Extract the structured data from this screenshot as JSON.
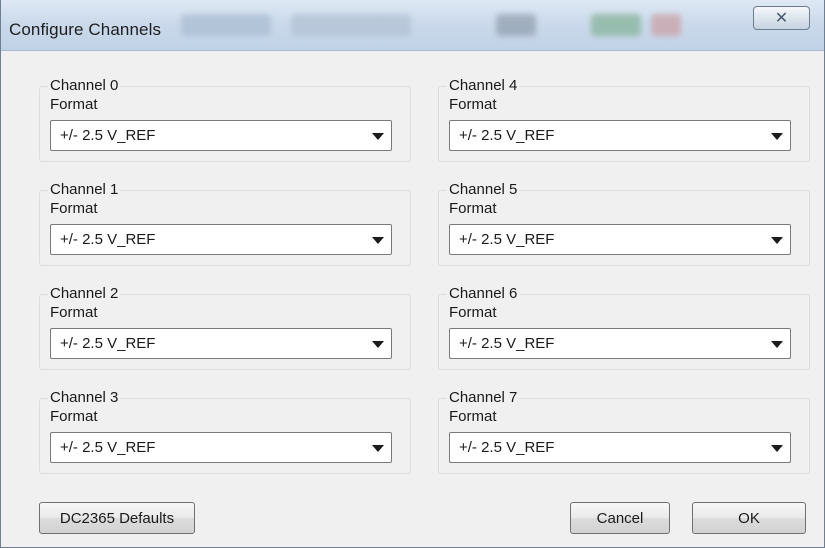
{
  "window": {
    "title": "Configure Channels",
    "close_glyph": "✕"
  },
  "channels": [
    {
      "title": "Channel 0",
      "format_label": "Format",
      "value": "+/- 2.5 V_REF"
    },
    {
      "title": "Channel 1",
      "format_label": "Format",
      "value": "+/- 2.5 V_REF"
    },
    {
      "title": "Channel 2",
      "format_label": "Format",
      "value": "+/- 2.5 V_REF"
    },
    {
      "title": "Channel 3",
      "format_label": "Format",
      "value": "+/- 2.5 V_REF"
    },
    {
      "title": "Channel 4",
      "format_label": "Format",
      "value": "+/- 2.5 V_REF"
    },
    {
      "title": "Channel 5",
      "format_label": "Format",
      "value": "+/- 2.5 V_REF"
    },
    {
      "title": "Channel 6",
      "format_label": "Format",
      "value": "+/- 2.5 V_REF"
    },
    {
      "title": "Channel 7",
      "format_label": "Format",
      "value": "+/- 2.5 V_REF"
    }
  ],
  "buttons": {
    "defaults": "DC2365 Defaults",
    "cancel": "Cancel",
    "ok": "OK"
  },
  "icons": {
    "close": "close-icon",
    "dropdown": "chevron-down-icon"
  },
  "colors": {
    "titlebar": "#cbdaeb",
    "dialog_bg": "#f0f0f0",
    "group_border": "#dcdcdc"
  }
}
